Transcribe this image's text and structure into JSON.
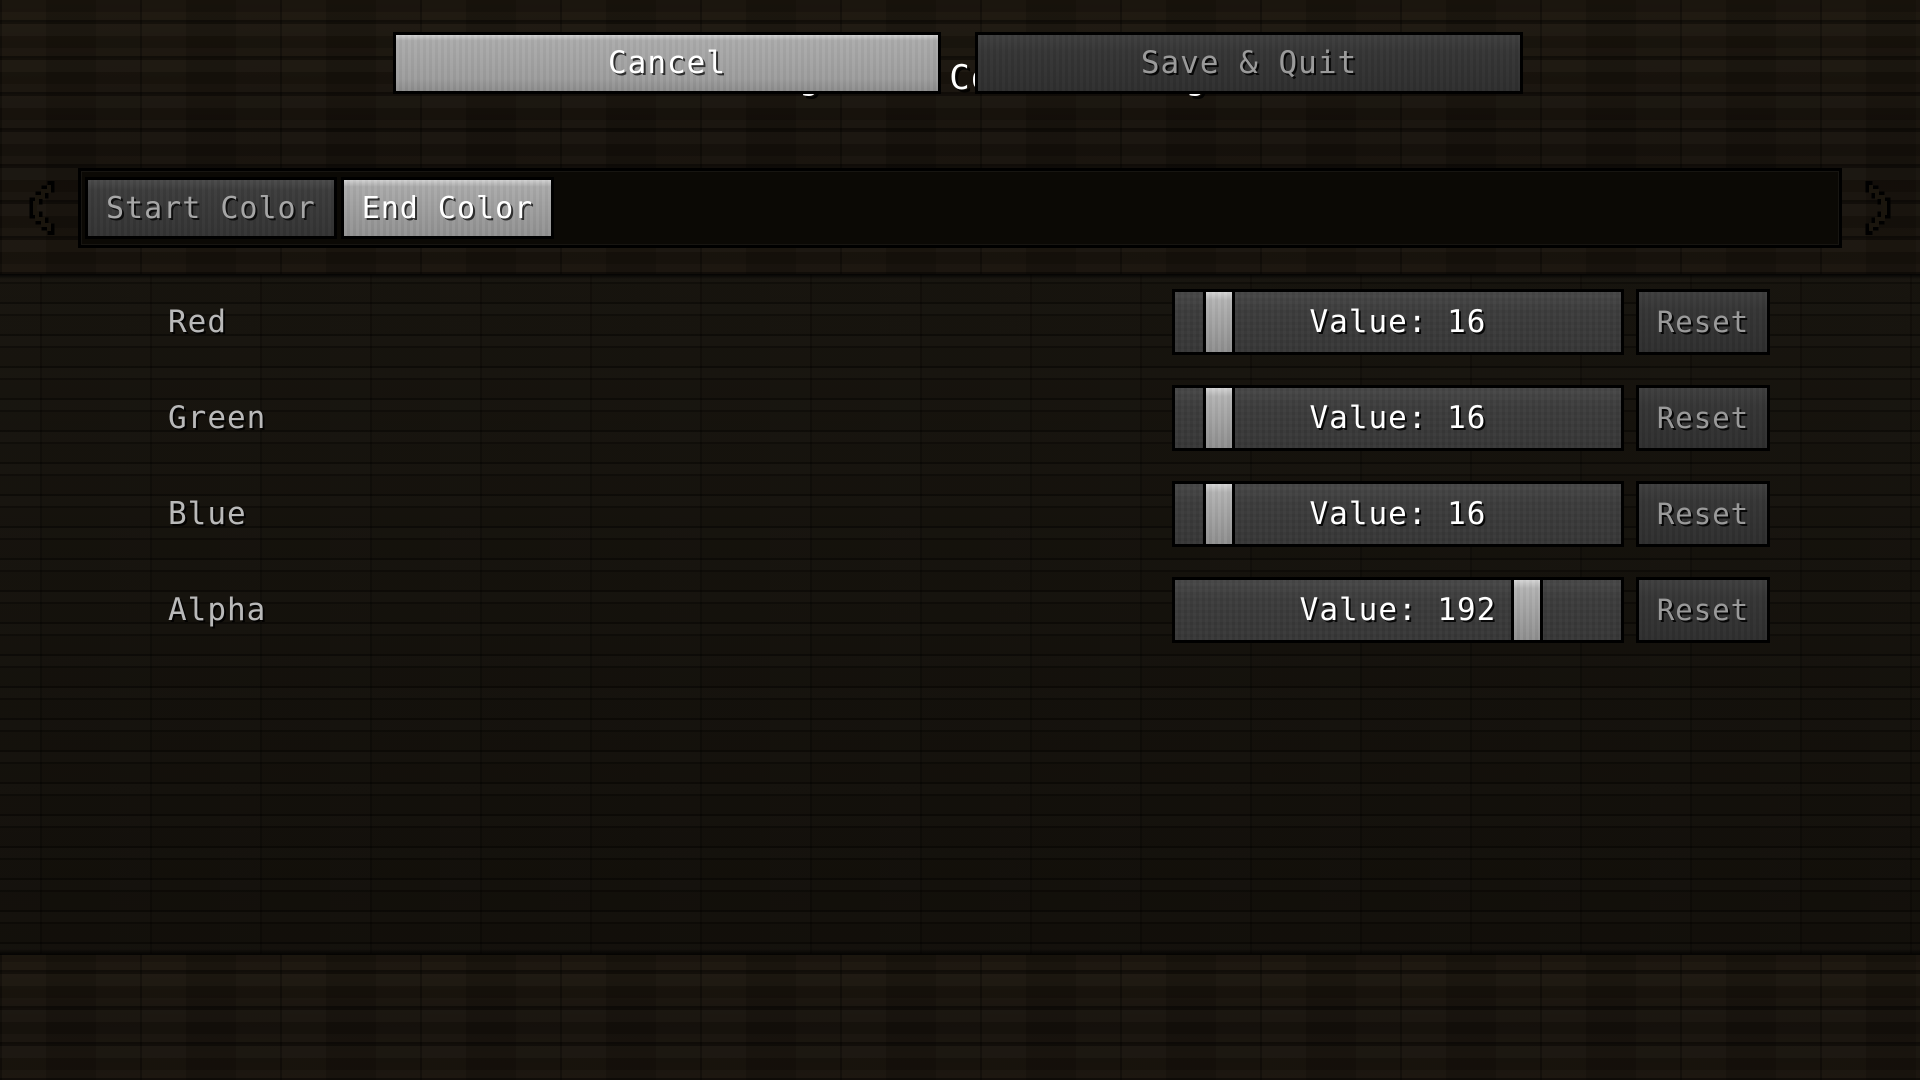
{
  "header": {
    "title": "Background Color config"
  },
  "tabs": {
    "prev_icon": "chevron-left-icon",
    "next_icon": "chevron-right-icon",
    "items": [
      {
        "label": "Start Color",
        "active": false
      },
      {
        "label": "End Color",
        "active": true
      }
    ]
  },
  "options": [
    {
      "label": "Red",
      "value_text": "Value: 16",
      "value": 16,
      "max": 255,
      "handle_pct": 6.3,
      "reset_label": "Reset"
    },
    {
      "label": "Green",
      "value_text": "Value: 16",
      "value": 16,
      "max": 255,
      "handle_pct": 6.3,
      "reset_label": "Reset"
    },
    {
      "label": "Blue",
      "value_text": "Value: 16",
      "value": 16,
      "max": 255,
      "handle_pct": 6.3,
      "reset_label": "Reset"
    },
    {
      "label": "Alpha",
      "value_text": "Value: 192",
      "value": 192,
      "max": 255,
      "handle_pct": 75.3,
      "reset_label": "Reset"
    }
  ],
  "footer": {
    "cancel_label": "Cancel",
    "save_quit_label": "Save & Quit"
  },
  "colors": {
    "wood": "#34291a",
    "content_bg": "#100c07",
    "text_primary": "#ffffff",
    "text_muted": "#9a9a9a",
    "tab_active_bg": "#a8a8a8",
    "tab_inactive_bg": "#3c3c3c"
  }
}
